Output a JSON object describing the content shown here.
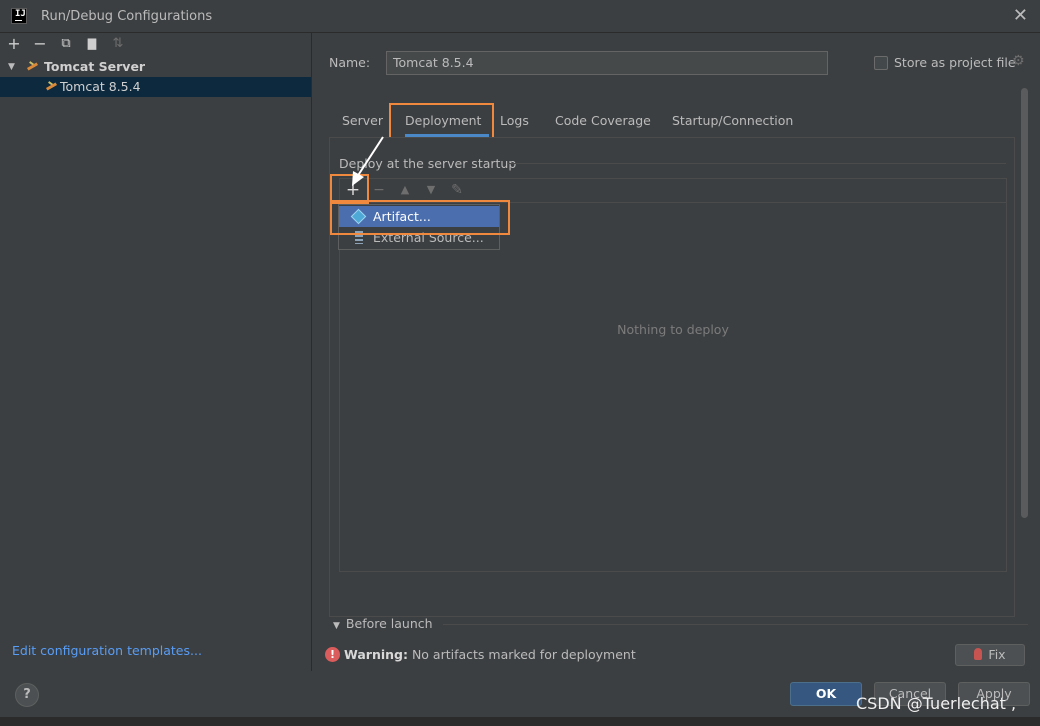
{
  "window": {
    "title": "Run/Debug Configurations",
    "app_icon_text": "IJ"
  },
  "left": {
    "toolbar": {
      "add": "+",
      "remove": "−",
      "copy": "⧉",
      "folder": "▇",
      "sort": "⇅"
    },
    "tree": [
      {
        "label": "Tomcat Server",
        "expanded": true
      },
      {
        "label": "Tomcat 8.5.4",
        "selected": true
      }
    ],
    "edit_templates": "Edit configuration templates..."
  },
  "form": {
    "name_label": "Name:",
    "name_value": "Tomcat 8.5.4",
    "store_label": "Store as project file",
    "tabs": [
      "Server",
      "Deployment",
      "Logs",
      "Code Coverage",
      "Startup/Connection"
    ],
    "active_tab": "Deployment"
  },
  "deployment": {
    "section_label": "Deploy at the server startup",
    "empty_text": "Nothing to deploy",
    "popup_items": [
      "Artifact...",
      "External Source..."
    ]
  },
  "before_launch": "Before launch",
  "warning": {
    "bold": "Warning:",
    "text": " No artifacts marked for deployment"
  },
  "fix_label": "Fix",
  "buttons": {
    "ok": "OK",
    "cancel": "Cancel",
    "apply": "Apply",
    "help": "?"
  },
  "watermark": "CSDN @Tuerlechat ,",
  "colors": {
    "highlight": "#f0883e",
    "accent": "#4a88c7",
    "selection": "#4b6eaf"
  }
}
